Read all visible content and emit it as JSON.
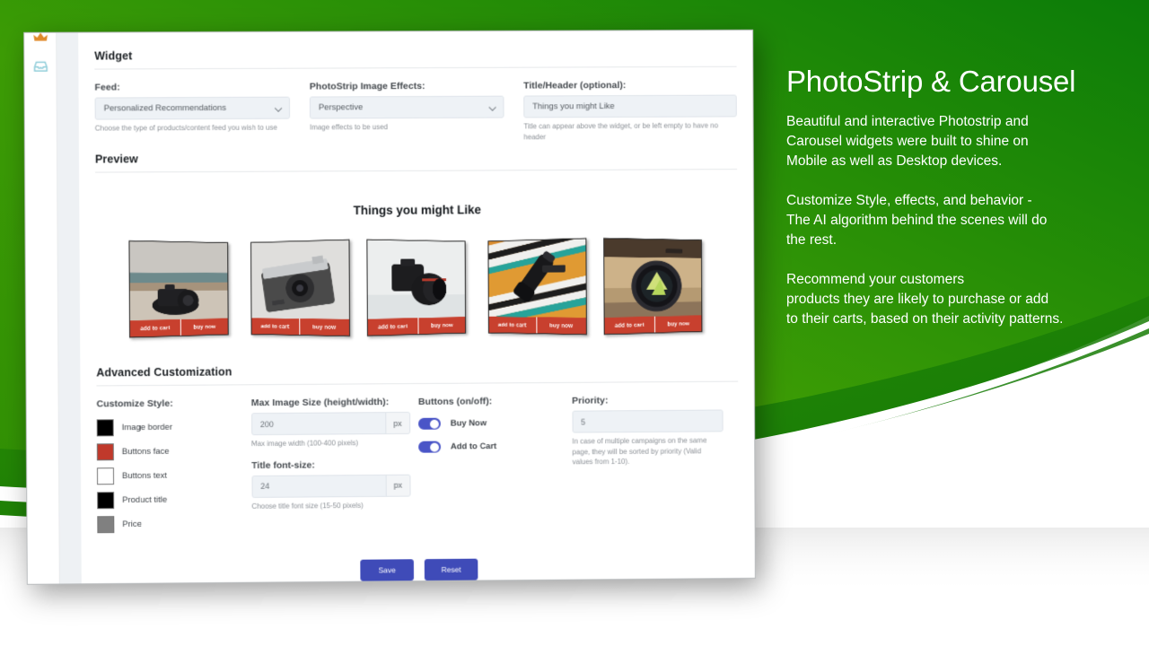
{
  "background": {
    "green_light": "#3f9c06",
    "green_dark": "#0b7c08",
    "swoosh_color": "#ffffff"
  },
  "window": {
    "rail": {
      "icons": [
        {
          "name": "crown-icon",
          "color": "#e08a2a"
        },
        {
          "name": "inbox-icon",
          "color": "#8fcdd9"
        }
      ]
    },
    "widget_section": {
      "title": "Widget",
      "fields": [
        {
          "label": "Feed:",
          "value": "Personalized Recommendations",
          "hint": "Choose the type of products/content feed you wish to use",
          "control": "select"
        },
        {
          "label": "PhotoStrip Image Effects:",
          "value": "Perspective",
          "hint": "Image effects to be used",
          "control": "select"
        },
        {
          "label": "Title/Header (optional):",
          "value": "Things you might Like",
          "hint": "Title can appear above the widget, or be left empty to have no header",
          "control": "text"
        }
      ]
    },
    "preview_section": {
      "title": "Preview",
      "widget_title": "Things you might Like",
      "card_button_add": "add to cart",
      "card_button_buy": "buy now",
      "cards": [
        {
          "name": "dslr-on-sand",
          "tilt": "right"
        },
        {
          "name": "vintage-film-camera",
          "tilt": "left"
        },
        {
          "name": "dslr-white-background",
          "tilt": "right"
        },
        {
          "name": "telephoto-on-striped-cloth",
          "tilt": "left"
        },
        {
          "name": "lens-close-up",
          "tilt": "right"
        }
      ]
    },
    "advanced_section": {
      "title": "Advanced Customization",
      "customize_style": {
        "label": "Customize Style:",
        "swatches": [
          {
            "label": "Image border",
            "color": "#000000"
          },
          {
            "label": "Buttons face",
            "color": "#c0392b"
          },
          {
            "label": "Buttons text",
            "color": "#ffffff"
          },
          {
            "label": "Product title",
            "color": "#000000"
          },
          {
            "label": "Price",
            "color": "#808080"
          }
        ]
      },
      "max_image_size": {
        "label": "Max Image Size (height/width):",
        "value": "200",
        "unit": "px",
        "hint": "Max image width (100-400 pixels)"
      },
      "title_font_size": {
        "label": "Title font-size:",
        "value": "24",
        "unit": "px",
        "hint": "Choose title font size (15-50 pixels)"
      },
      "buttons_toggle": {
        "label": "Buttons (on/off):",
        "items": [
          {
            "label": "Buy Now",
            "state": "on"
          },
          {
            "label": "Add to Cart",
            "state": "on"
          }
        ]
      },
      "priority": {
        "label": "Priority:",
        "value": "5",
        "hint": "In case of multiple campaigns on the same page, they will be sorted by priority (Valid values from 1-10)."
      }
    },
    "footer": {
      "save_label": "Save",
      "reset_label": "Reset"
    }
  },
  "promo": {
    "heading": "PhotoStrip & Carousel",
    "paragraph_1_lines": [
      "Beautiful and interactive Photostrip and",
      "Carousel widgets were built to shine on",
      "Mobile as well as Desktop devices."
    ],
    "paragraph_2_lines": [
      "Customize Style, effects, and behavior -",
      "The AI algorithm behind the scenes will do",
      "the rest."
    ],
    "paragraph_3_lines": [
      "Recommend your customers",
      "products they are likely to purchase or add",
      "to their carts, based on their activity patterns."
    ]
  }
}
